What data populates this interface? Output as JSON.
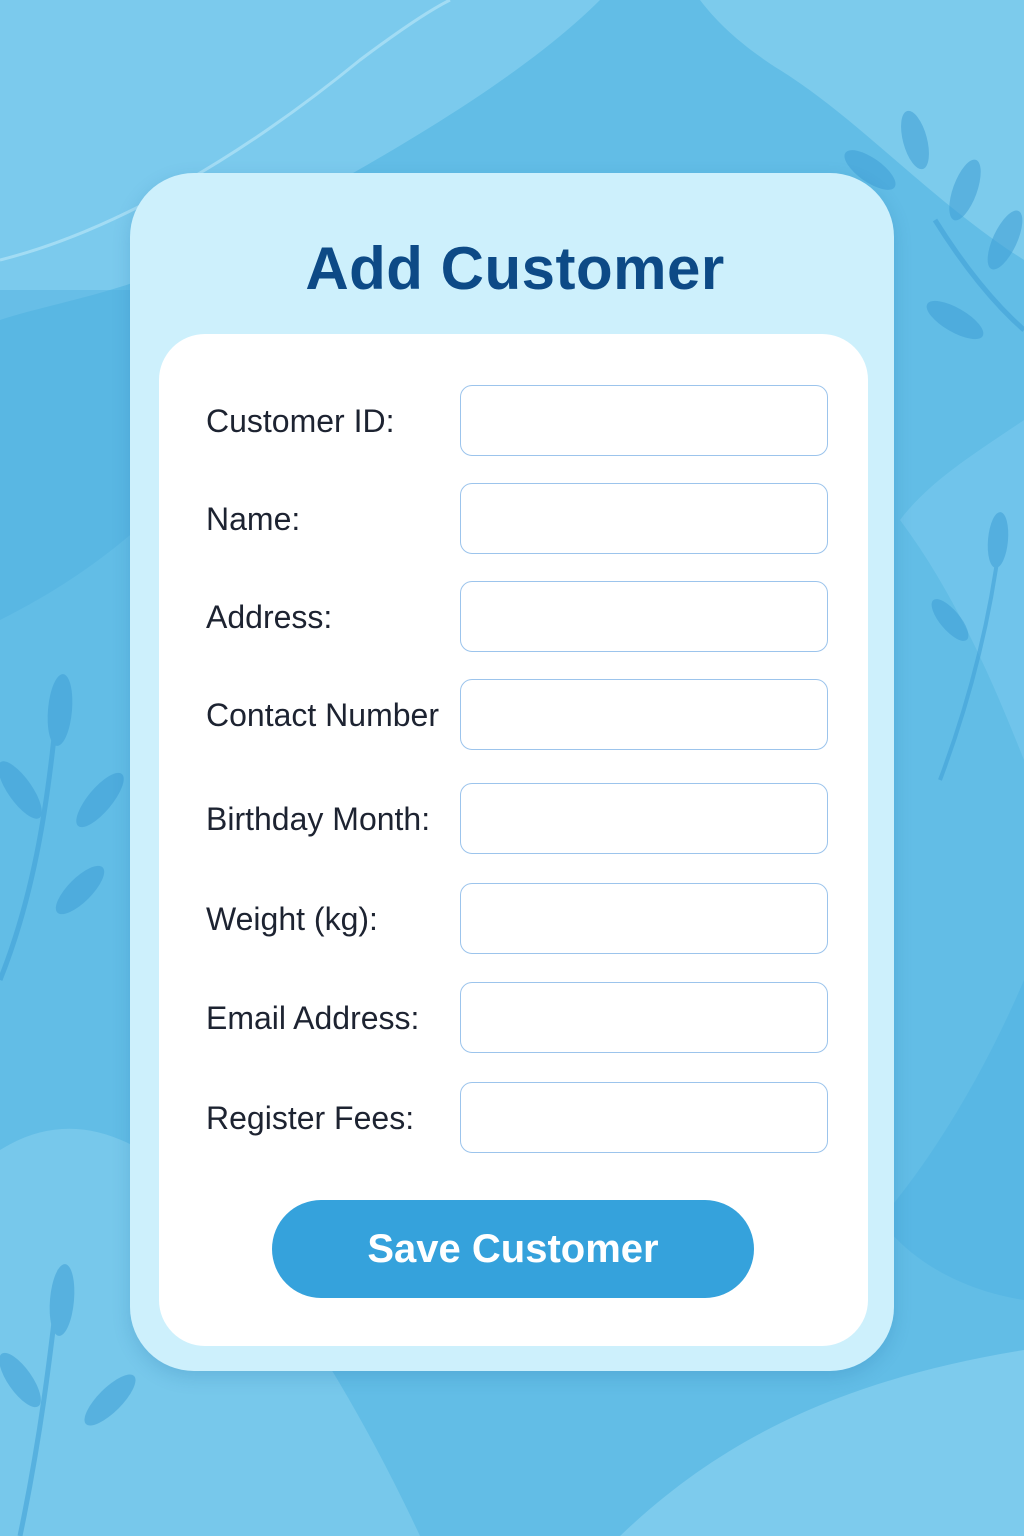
{
  "form": {
    "title": "Add Customer",
    "fields": [
      {
        "label": "Customer ID:",
        "value": ""
      },
      {
        "label": "Name:",
        "value": ""
      },
      {
        "label": "Address:",
        "value": ""
      },
      {
        "label": "Contact Number",
        "value": ""
      },
      {
        "label": "Birthday Month:",
        "value": ""
      },
      {
        "label": "Weight (kg):",
        "value": ""
      },
      {
        "label": "Email Address:",
        "value": ""
      },
      {
        "label": "Register Fees:",
        "value": ""
      }
    ],
    "save_label": "Save Customer"
  },
  "colors": {
    "background": "#62bde6",
    "card": "#cdf0fc",
    "title": "#0d4a86",
    "button": "#35a2dc",
    "field_border": "#9cc4ec"
  }
}
